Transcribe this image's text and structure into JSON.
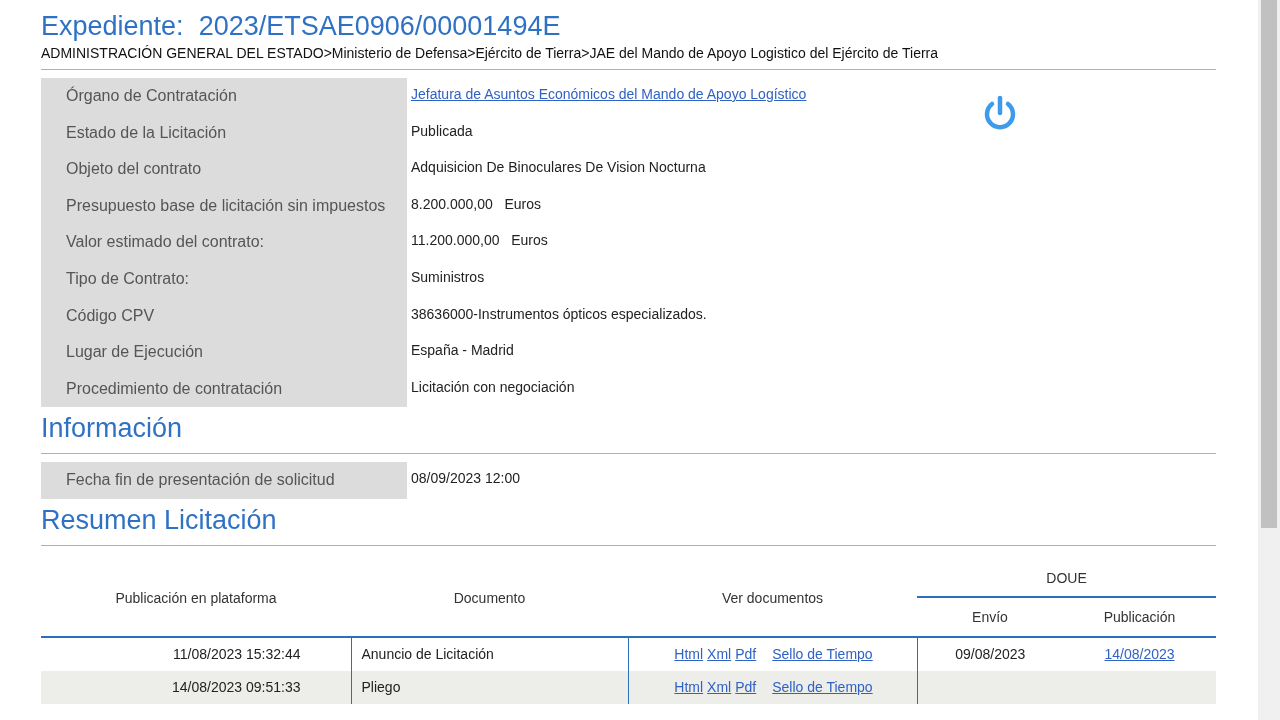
{
  "title": {
    "label": "Expediente:",
    "value": "2023/ETSAE0906/00001494E"
  },
  "breadcrumb": "ADMINISTRACIÓN GENERAL DEL ESTADO>Ministerio de Defensa>Ejército de Tierra>JAE del Mando de Apoyo Logistico del Ejército de Tierra",
  "details": [
    {
      "label": "Órgano de Contratación",
      "value": "Jefatura de Asuntos Económicos del Mando de Apoyo Logístico",
      "kind": "link"
    },
    {
      "label": "Estado de la Licitación",
      "value": "Publicada",
      "kind": "text"
    },
    {
      "label": "Objeto del contrato",
      "value": "Adquisicion De Binoculares De Vision Nocturna",
      "kind": "text"
    },
    {
      "label": "Presupuesto base de licitación sin impuestos",
      "value": "8.200.000,00   Euros",
      "kind": "text"
    },
    {
      "label": "Valor estimado del contrato:",
      "value": "11.200.000,00   Euros",
      "kind": "text"
    },
    {
      "label": "Tipo de Contrato:",
      "value": "Suministros",
      "kind": "text"
    },
    {
      "label": "Código CPV",
      "value": "38636000-Instrumentos ópticos especializados.",
      "kind": "text"
    },
    {
      "label": "Lugar de Ejecución",
      "value": "España - Madrid",
      "kind": "text"
    },
    {
      "label": "Procedimiento de contratación",
      "value": "Licitación con negociación",
      "kind": "text"
    }
  ],
  "informacion": {
    "heading": "Información",
    "rows": [
      {
        "label": "Fecha fin de presentación de solicitud",
        "value": "08/09/2023 12:00"
      }
    ]
  },
  "resumen": {
    "heading": "Resumen Licitación",
    "columns": {
      "publicacion": "Publicación en plataforma",
      "documento": "Documento",
      "ver": "Ver documentos",
      "doue": "DOUE",
      "envio": "Envío",
      "doue_publicacion": "Publicación"
    },
    "rows": [
      {
        "publicacion": "11/08/2023 15:32:44",
        "documento": "Anuncio de Licitación",
        "links": [
          "Html",
          "Xml",
          "Pdf"
        ],
        "sello": "Sello de Tiempo",
        "envio": "09/08/2023",
        "doue_publicacion": "14/08/2023"
      },
      {
        "publicacion": "14/08/2023 09:51:33",
        "documento": "Pliego",
        "links": [
          "Html",
          "Xml",
          "Pdf"
        ],
        "sello": "Sello de Tiempo"
      }
    ]
  }
}
